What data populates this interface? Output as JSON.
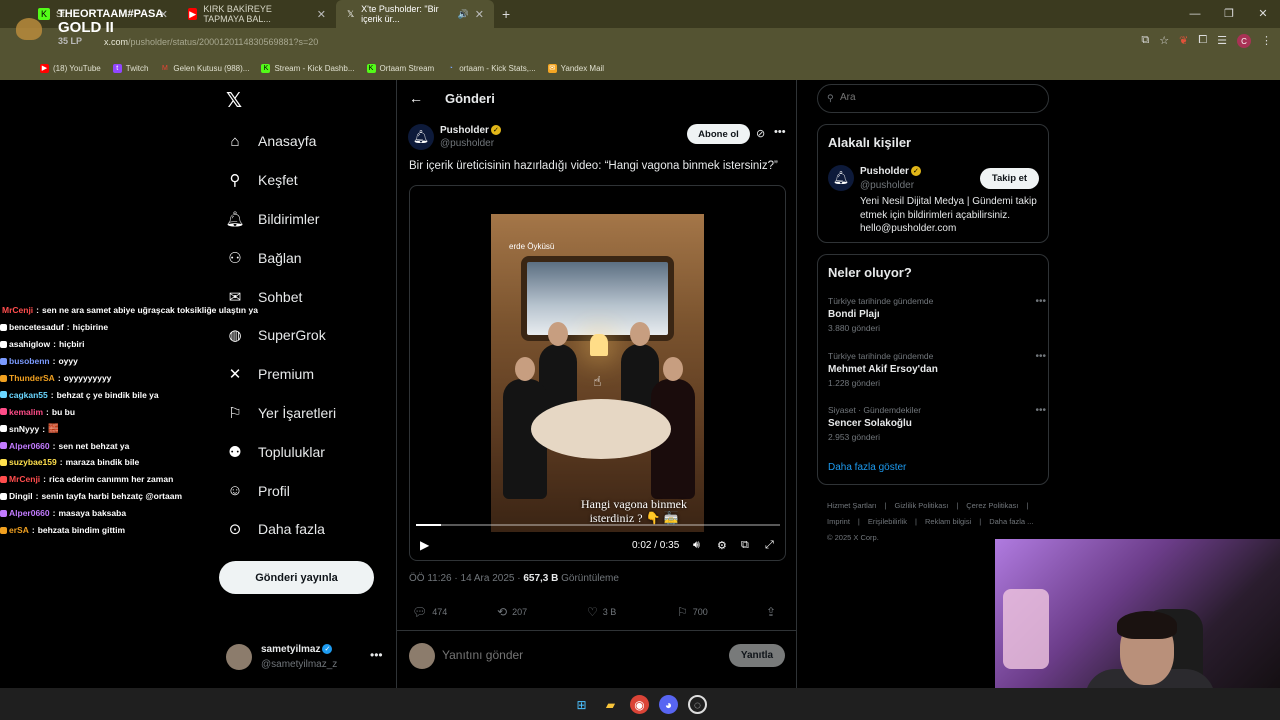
{
  "browser": {
    "tabs": [
      {
        "title": "St...",
        "icon": "kick-icon",
        "color": "#53fc18"
      },
      {
        "title": "KIRK BAKİREYE TAPMAYA BAL...",
        "icon": "youtube-icon",
        "color": "#ff0000"
      },
      {
        "title": "X'te Pusholder: \"Bir içerik ür...",
        "icon": "x-icon",
        "color": "#ffffff"
      }
    ],
    "url_host": "x.com",
    "url_path": "/pusholder/status/2000120114830569881?s=20",
    "profile_letter": "C",
    "bookmarks": [
      {
        "label": "(18) YouTube",
        "icon": "youtube-icon",
        "color": "#ff0000"
      },
      {
        "label": "Twitch",
        "icon": "twitch-icon",
        "color": "#9146ff"
      },
      {
        "label": "Gelen Kutusu (988)...",
        "icon": "gmail-icon",
        "color": "#ea4335"
      },
      {
        "label": "Stream - Kick Dashb...",
        "icon": "kick-icon",
        "color": "#53fc18"
      },
      {
        "label": "Ortaam Stream",
        "icon": "kick-icon",
        "color": "#53fc18"
      },
      {
        "label": "ortaam - Kick Stats,...",
        "icon": "stats-icon",
        "color": "#7aa7ff"
      },
      {
        "label": "Yandex Mail",
        "icon": "mail-icon",
        "color": "#f5a623"
      }
    ]
  },
  "overlay_rank": {
    "name": "THEORTAAM#PASA",
    "tier": "GOLD II",
    "lp": "35 LP"
  },
  "nav": {
    "items": [
      {
        "label": "Anasayfa",
        "icon": "home-icon",
        "glyph": "⌂"
      },
      {
        "label": "Keşfet",
        "icon": "search-icon",
        "glyph": "⚲"
      },
      {
        "label": "Bildirimler",
        "icon": "bell-icon",
        "glyph": "♢"
      },
      {
        "label": "Bağlan",
        "icon": "add-person-icon",
        "glyph": "⚇"
      },
      {
        "label": "Sohbet",
        "icon": "mail-icon",
        "glyph": "✉"
      },
      {
        "label": "SuperGrok",
        "icon": "grok-icon",
        "glyph": "◍"
      },
      {
        "label": "Premium",
        "icon": "x-icon",
        "glyph": "✕"
      },
      {
        "label": "Yer İşaretleri",
        "icon": "bookmark-icon",
        "glyph": "⚑"
      },
      {
        "label": "Topluluklar",
        "icon": "communities-icon",
        "glyph": "⚉"
      },
      {
        "label": "Profil",
        "icon": "profile-icon",
        "glyph": "⚲"
      },
      {
        "label": "Daha fazla",
        "icon": "more-circle-icon",
        "glyph": "⊙"
      }
    ],
    "post_button": "Gönderi yayınla",
    "account_name": "sametyilmaz",
    "account_handle": "@sametyilmaz_z"
  },
  "main": {
    "title": "Gönderi",
    "author_name": "Pusholder",
    "author_handle": "@pusholder",
    "follow_label": "Abone ol",
    "text": "Bir içerik üreticisinin hazırladığı video: “Hangi vagona binmek istersiniz?”",
    "video": {
      "logo": "erde Öyküsü",
      "caption": "Hangi vagona binmek isterdiniz ? 👇 🚋",
      "time": "0:02 / 0:35",
      "progress": 0.07
    },
    "meta_time": "ÖÖ 11:26 · 14 Ara 2025 · ",
    "meta_views": "657,3 B",
    "meta_views_label": " Görüntüleme",
    "stats": {
      "replies": "474",
      "reposts": "207",
      "likes": "3 B",
      "bookmarks": "700"
    },
    "reply_placeholder": "Yanıtını gönder",
    "reply_button": "Yanıtla"
  },
  "sidebar": {
    "search_placeholder": "Ara",
    "related_title": "Alakalı kişiler",
    "related": {
      "name": "Pusholder",
      "handle": "@pusholder",
      "follow_label": "Takip et",
      "bio": "Yeni Nesil Dijital Medya | Gündemi takip etmek için bildirimleri açabilirsiniz. hello@pusholder.com"
    },
    "trends_title": "Neler oluyor?",
    "trends": [
      {
        "context": "Türkiye tarihinde gündemde",
        "title": "Bondi Plajı",
        "count": "3.880 gönderi"
      },
      {
        "context": "Türkiye tarihinde gündemde",
        "title": "Mehmet Akif Ersoy'dan",
        "count": "1.228 gönderi"
      },
      {
        "context": "Siyaset · Gündemdekiler",
        "title": "Sencer Solakoğlu",
        "count": "2.953 gönderi"
      }
    ],
    "show_more": "Daha fazla göster",
    "footer": [
      "Hizmet Şartları",
      "|",
      "Gizlilik Politikası",
      "|",
      "Çerez Politikası",
      "|",
      "Imprint",
      "|",
      "Erişilebilirlik",
      "|",
      "Reklam bilgisi",
      "|",
      "Daha fazla ...",
      "© 2025 X Corp."
    ]
  },
  "chat": [
    {
      "user": "MrCenji",
      "msg": "sen ne ara samet abiye uğraşcak toksikliğe ulaştın ya",
      "color": "#ff4d4d"
    },
    {
      "user": "bencetesaduf",
      "msg": "hiçbirine",
      "color": "#ffffff"
    },
    {
      "user": "asahiglow",
      "msg": "hiçbiri",
      "color": "#ffffff"
    },
    {
      "user": "busobenn",
      "msg": "oyyy",
      "color": "#7b9bff"
    },
    {
      "user": "ThunderSA",
      "msg": "oyyyyyyyyy",
      "color": "#f0a020"
    },
    {
      "user": "cagkan55",
      "msg": "behzat ç ye bindik bile ya",
      "color": "#6ad6ff"
    },
    {
      "user": "kemalim",
      "msg": "bu bu",
      "color": "#ff4d88"
    },
    {
      "user": "snNyyy",
      "msg": "🧱",
      "color": "#ffffff"
    },
    {
      "user": "Alper0660",
      "msg": "sen net behzat ya",
      "color": "#c27bff"
    },
    {
      "user": "suzybae159",
      "msg": "maraza bindik bile",
      "color": "#ffe04d"
    },
    {
      "user": "MrCenji",
      "msg": "rica ederim canımm her zaman",
      "color": "#ff4d4d"
    },
    {
      "user": "Dingil",
      "msg": "senin tayfa harbi behzatç @ortaam",
      "color": "#ffffff"
    },
    {
      "user": "Alper0660",
      "msg": "masaya baksaba",
      "color": "#c27bff"
    },
    {
      "user": "erSA",
      "msg": "behzata bindim gittim",
      "color": "#f0a020"
    }
  ]
}
